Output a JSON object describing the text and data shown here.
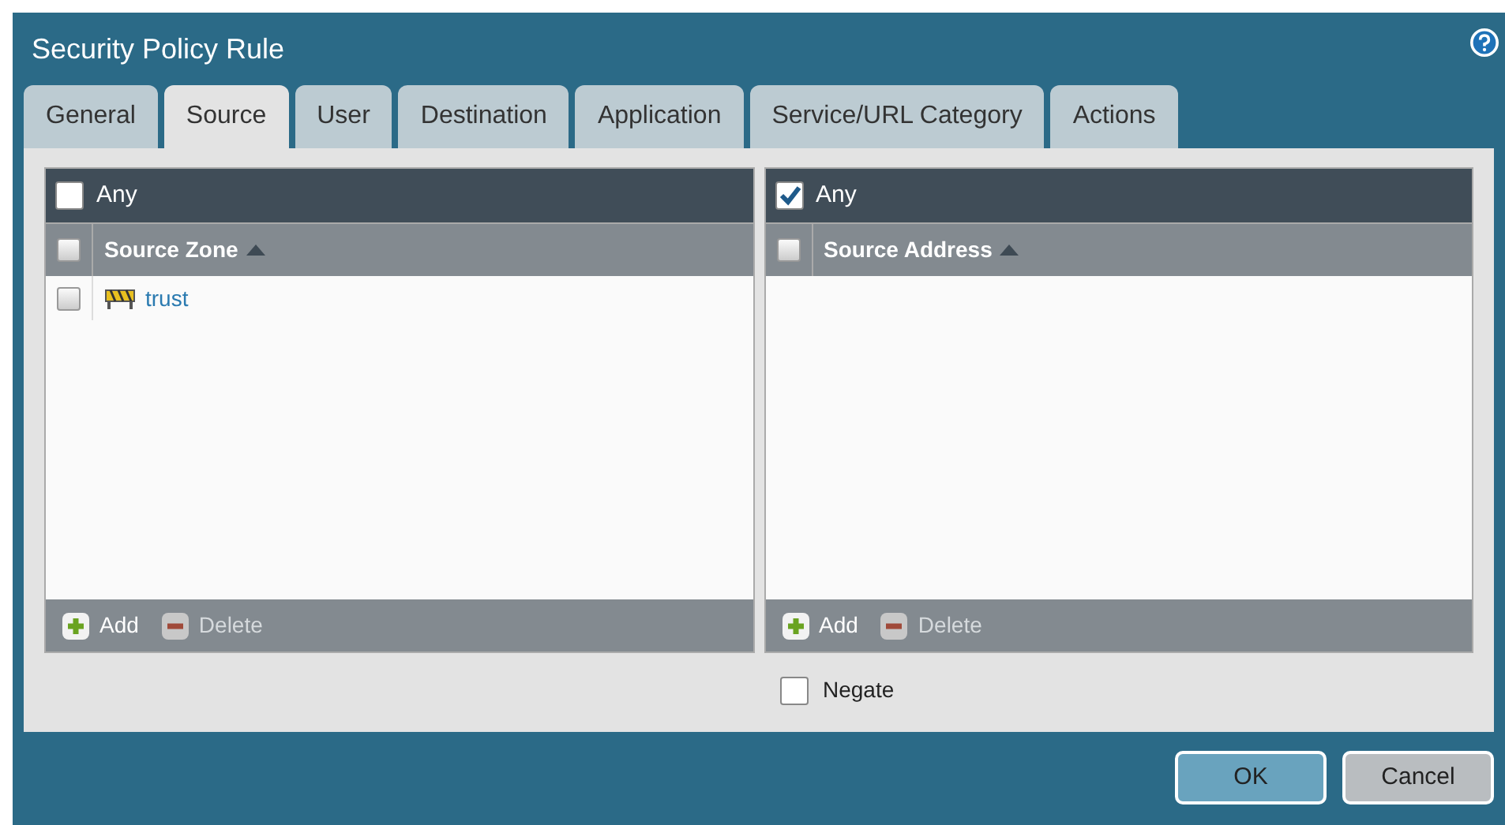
{
  "window": {
    "title": "Security Policy Rule"
  },
  "tabs": [
    {
      "label": "General",
      "selected": false
    },
    {
      "label": "Source",
      "selected": true
    },
    {
      "label": "User",
      "selected": false
    },
    {
      "label": "Destination",
      "selected": false
    },
    {
      "label": "Application",
      "selected": false
    },
    {
      "label": "Service/URL Category",
      "selected": false
    },
    {
      "label": "Actions",
      "selected": false
    }
  ],
  "panels": [
    {
      "any": {
        "label": "Any",
        "checked": false
      },
      "column": "Source Zone",
      "header_checked": false,
      "rows": [
        {
          "label": "trust",
          "checked": false
        }
      ],
      "footer": [
        {
          "kind": "add",
          "label": "Add",
          "disabled": false
        },
        {
          "kind": "delete",
          "label": "Delete",
          "disabled": true
        }
      ]
    },
    {
      "any": {
        "label": "Any",
        "checked": true
      },
      "column": "Source Address",
      "header_checked": false,
      "footer": [
        {
          "kind": "add",
          "label": "Add",
          "disabled": false
        },
        {
          "kind": "delete",
          "label": "Delete",
          "disabled": true
        }
      ]
    }
  ],
  "negate": {
    "label": "Negate",
    "checked": false
  },
  "buttons": [
    {
      "label": "OK",
      "kind": "primary"
    },
    {
      "label": "Cancel",
      "kind": "secondary"
    }
  ]
}
